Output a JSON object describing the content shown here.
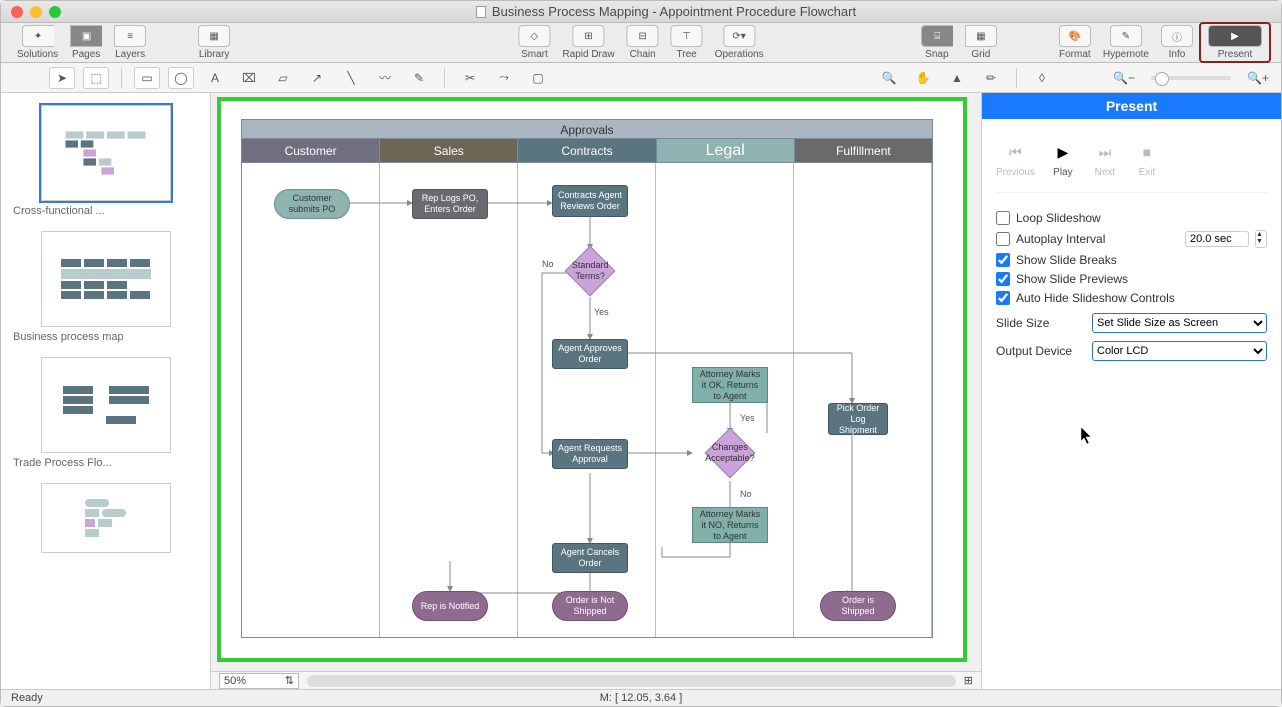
{
  "title": "Business Process Mapping - Appointment Procedure Flowchart",
  "toolbar": {
    "solutions": "Solutions",
    "pages": "Pages",
    "layers": "Layers",
    "library": "Library",
    "smart": "Smart",
    "rapidDraw": "Rapid Draw",
    "chain": "Chain",
    "tree": "Tree",
    "operations": "Operations",
    "snap": "Snap",
    "grid": "Grid",
    "format": "Format",
    "hypernote": "Hypernote",
    "info": "Info",
    "present": "Present"
  },
  "sidebar": {
    "thumb1": "Cross-functional ...",
    "thumb2": "Business process map",
    "thumb3": "Trade Process Flo..."
  },
  "swimlane": {
    "title": "Approvals",
    "lanes": [
      "Customer",
      "Sales",
      "Contracts",
      "Legal",
      "Fulfillment"
    ],
    "nodes": {
      "n1": "Customer submits PO",
      "n2": "Rep Logs PO, Enters Order",
      "n3": "Contracts Agent Reviews Order",
      "n4": "Standard Terms?",
      "n5": "Agent Approves Order",
      "n6": "Agent Requests Approval",
      "n7": "Agent Cancels Order",
      "n8": "Attorney Marks it OK, Returns to Agent",
      "n9": "Changes Acceptable?",
      "n10": "Attorney Marks it NO, Returns to Agent",
      "n11": "Pick Order Log Shipment",
      "n12": "Rep is Notified",
      "n13": "Order is Not Shipped",
      "n14": "Order is Shipped"
    },
    "labels": {
      "no1": "No",
      "yes1": "Yes",
      "yes2": "Yes",
      "no2": "No"
    }
  },
  "panel": {
    "title": "Present",
    "previous": "Previous",
    "play": "Play",
    "next": "Next",
    "exit": "Exit",
    "loop": "Loop Slideshow",
    "autoplay": "Autoplay Interval",
    "interval": "20.0 sec",
    "breaks": "Show Slide Breaks",
    "previews": "Show Slide Previews",
    "autohide": "Auto Hide Slideshow Controls",
    "slideSizeLabel": "Slide Size",
    "slideSizeValue": "Set Slide Size as Screen",
    "outputLabel": "Output Device",
    "outputValue": "Color LCD"
  },
  "canvasBottom": {
    "zoom": "50%"
  },
  "status": {
    "ready": "Ready",
    "mouse": "M: [ 12.05, 3.64 ]"
  }
}
